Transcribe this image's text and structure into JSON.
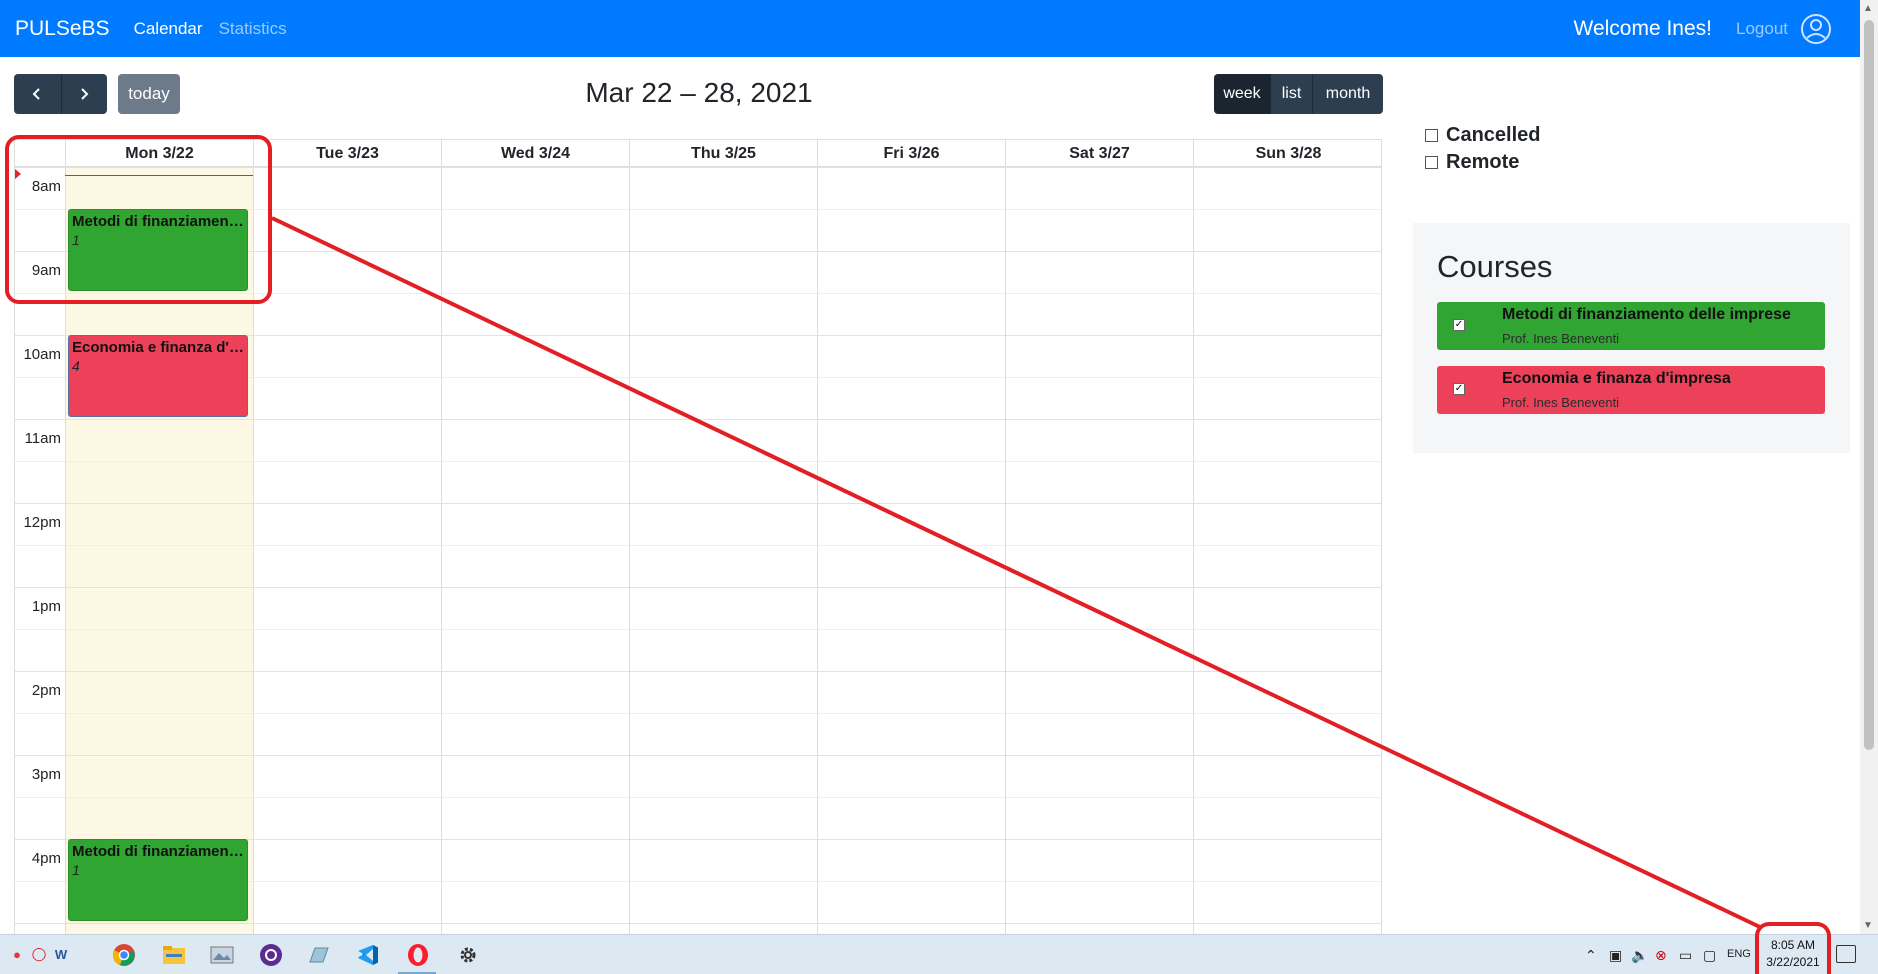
{
  "navbar": {
    "brand": "PULSeBS",
    "links": [
      "Calendar",
      "Statistics"
    ],
    "welcome": "Welcome Ines!",
    "logout": "Logout"
  },
  "toolbar": {
    "prev_icon": "chevron-left-icon",
    "next_icon": "chevron-right-icon",
    "today": "today",
    "title": "Mar 22 – 28, 2021",
    "views": [
      "week",
      "list",
      "month"
    ],
    "active_view": "week"
  },
  "calendar": {
    "days": [
      "Mon 3/22",
      "Tue 3/23",
      "Wed 3/24",
      "Thu 3/25",
      "Fri 3/26",
      "Sat 3/27",
      "Sun 3/28"
    ],
    "today_index": 0,
    "times": [
      "8am",
      "9am",
      "10am",
      "11am",
      "12pm",
      "1pm",
      "2pm",
      "3pm",
      "4pm"
    ],
    "events": [
      {
        "title": "Metodi di finanziament...",
        "sub": "1",
        "color": "green",
        "day": 0,
        "start": "8:30",
        "end": "9:30"
      },
      {
        "title": "Economia e finanza d'i...",
        "sub": "4",
        "color": "red",
        "day": 0,
        "start": "10:00",
        "end": "11:00"
      },
      {
        "title": "Metodi di finanziament...",
        "sub": "1",
        "color": "green",
        "day": 0,
        "start": "16:00",
        "end": "17:00"
      }
    ]
  },
  "filters": [
    "Cancelled",
    "Remote"
  ],
  "courses": {
    "title": "Courses",
    "items": [
      {
        "name": "Metodi di finanziamento delle imprese",
        "prof": "Prof. Ines Beneventi",
        "color": "#31a532"
      },
      {
        "name": "Economia e finanza d'impresa",
        "prof": "Prof. Ines Beneventi",
        "color": "#ed415a"
      }
    ]
  },
  "taskbar": {
    "lang": "ENG",
    "time": "8:05 AM",
    "date": "3/22/2021"
  },
  "colors": {
    "navbar": "#007bff",
    "button_dark": "#2c3e50",
    "event_green": "#31a532",
    "event_red": "#ed415a",
    "today_bg": "#fcf8e3",
    "annotation": "#e31e24"
  }
}
